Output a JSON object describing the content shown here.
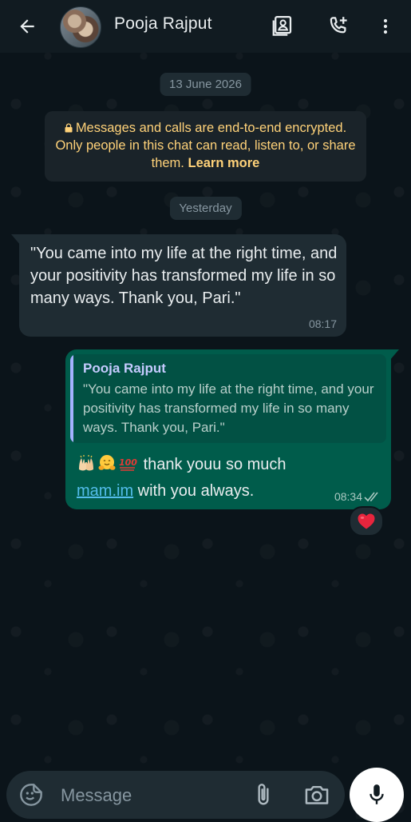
{
  "header": {
    "contact_name": "Pooja Rajput"
  },
  "chat": {
    "date_chip_1": "13 June 2026",
    "encryption_notice": "Messages and calls are end-to-end encrypted. Only people in this chat can read, listen to, or share them.",
    "learn_more": "Learn more",
    "date_chip_2": "Yesterday",
    "incoming": {
      "text": "\"You came into my life at the right time, and your positivity has transformed my life in so many ways. Thank you, Pari.\"",
      "time": "08:17"
    },
    "outgoing": {
      "quoted_name": "Pooja Rajput",
      "quoted_text": "\"You came into my life at the right time, and your positivity has transformed my life in so many ways. Thank you, Pari.\"",
      "text_before_link": "thank youu so much",
      "link_text": "mam.im",
      "text_after_link": "with you always.",
      "time": "08:34",
      "emojis": [
        "raising-hands-icon",
        "hugging-face-icon",
        "hundred-points-icon"
      ]
    },
    "reaction": "red-heart-icon"
  },
  "composer": {
    "placeholder": "Message"
  },
  "colors": {
    "background": "#0b141a",
    "header": "#111b21",
    "incoming_bubble": "#1f2c33",
    "outgoing_bubble": "#005c4b",
    "accent": "#00a884",
    "notice_text": "#ffd279",
    "link": "#53bdeb"
  }
}
